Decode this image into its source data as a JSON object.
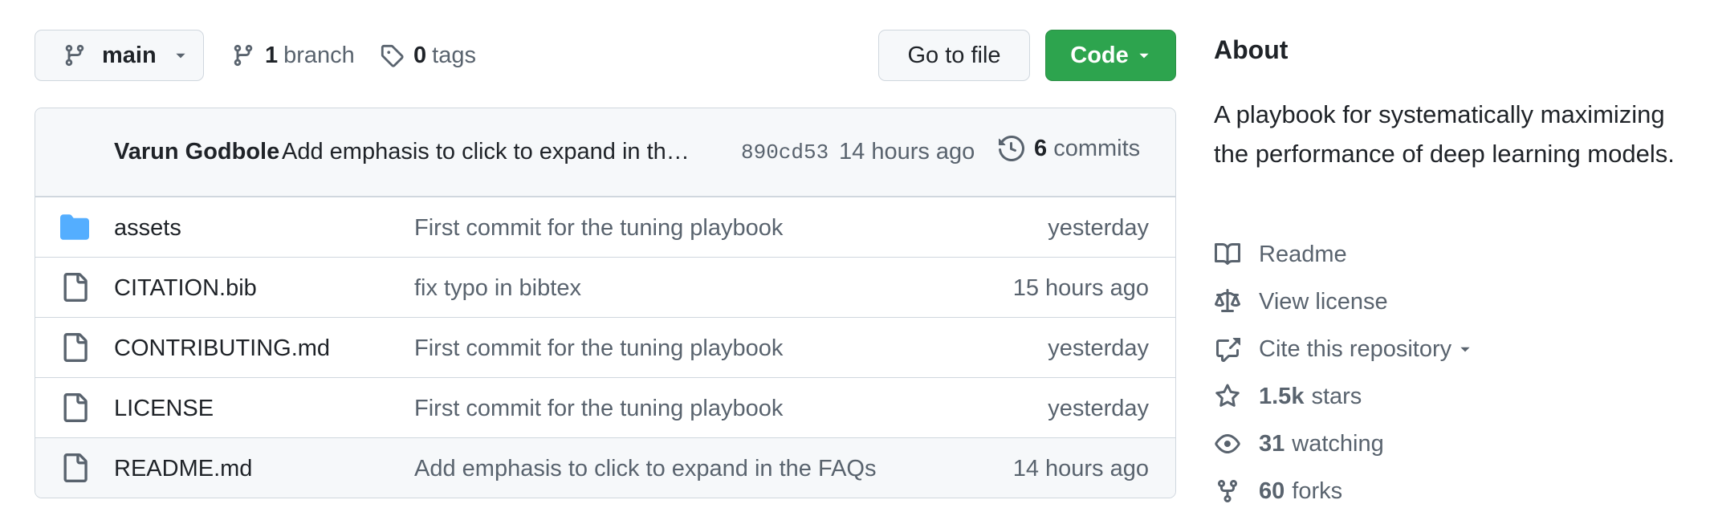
{
  "top_bar": {
    "branch_name": "main",
    "branches_count": "1",
    "branches_label": "branch",
    "tags_count": "0",
    "tags_label": "tags",
    "goto_file_label": "Go to file",
    "code_label": "Code"
  },
  "latest_commit": {
    "author": "Varun Godbole",
    "message": "Add emphasis to click to expand in th…",
    "sha": "890cd53",
    "time": "14 hours ago",
    "commits_count": "6",
    "commits_label": "commits"
  },
  "files": [
    {
      "type": "folder",
      "name": "assets",
      "message": "First commit for the tuning playbook",
      "age": "yesterday"
    },
    {
      "type": "file",
      "name": "CITATION.bib",
      "message": "fix typo in bibtex",
      "age": "15 hours ago"
    },
    {
      "type": "file",
      "name": "CONTRIBUTING.md",
      "message": "First commit for the tuning playbook",
      "age": "yesterday"
    },
    {
      "type": "file",
      "name": "LICENSE",
      "message": "First commit for the tuning playbook",
      "age": "yesterday"
    },
    {
      "type": "file",
      "name": "README.md",
      "message": "Add emphasis to click to expand in the FAQs",
      "age": "14 hours ago"
    }
  ],
  "about": {
    "title": "About",
    "description": "A playbook for systematically maximizing the performance of deep learning models.",
    "readme_label": "Readme",
    "license_label": "View license",
    "cite_label": "Cite this repository",
    "stars_count": "1.5k",
    "stars_label": "stars",
    "watching_count": "31",
    "watching_label": "watching",
    "forks_count": "60",
    "forks_label": "forks"
  },
  "colors": {
    "accent_green": "#2da44e",
    "folder_blue": "#54aeff",
    "muted_text": "#59636e",
    "border": "#d0d7de"
  }
}
